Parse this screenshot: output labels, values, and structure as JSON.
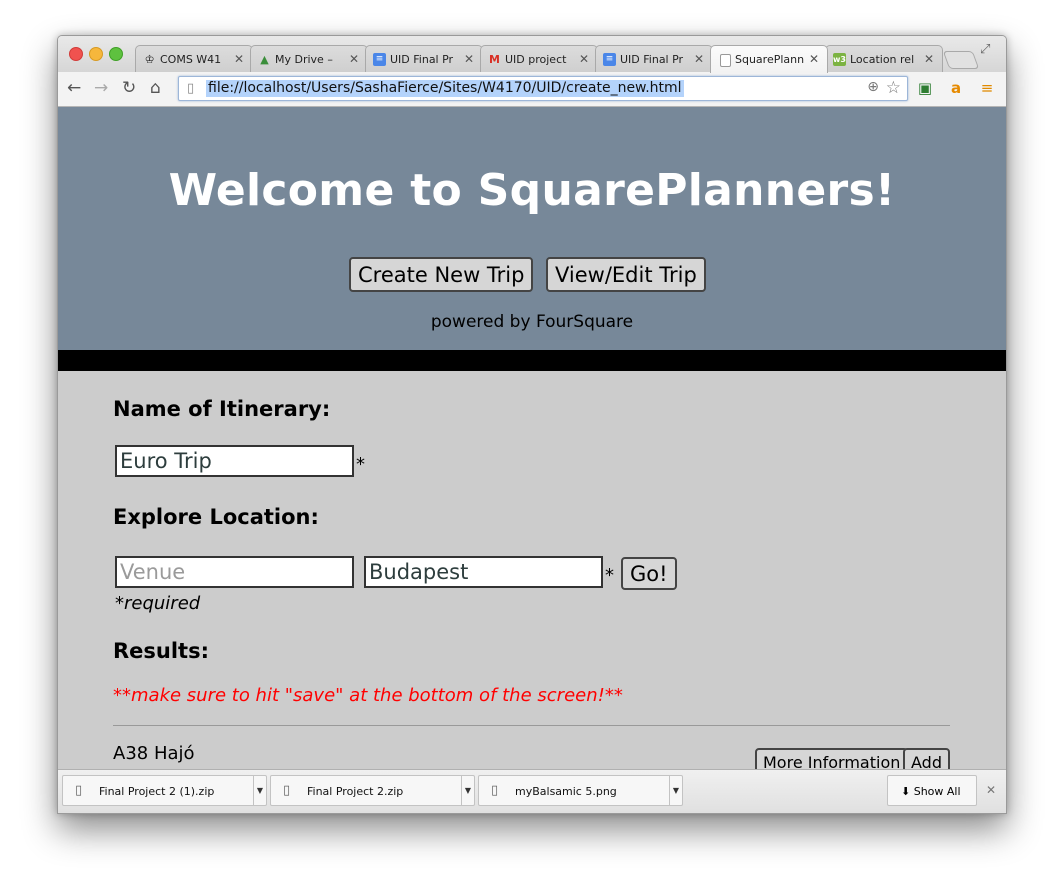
{
  "browser": {
    "tabs": [
      {
        "title": "COMS W41",
        "favicon": "crown-icon",
        "active": false
      },
      {
        "title": "My Drive –",
        "favicon": "google-drive-icon",
        "active": false
      },
      {
        "title": "UID Final Pr",
        "favicon": "google-docs-icon",
        "active": false
      },
      {
        "title": "UID project",
        "favicon": "gmail-icon",
        "active": false
      },
      {
        "title": "UID Final Pr",
        "favicon": "google-docs-icon",
        "active": false
      },
      {
        "title": "SquarePlann",
        "favicon": "page-icon",
        "active": true
      },
      {
        "title": "Location rel",
        "favicon": "w3c-icon",
        "active": false
      }
    ],
    "url": "file://localhost/Users/SashaFierce/Sites/W4170/UID/create_new.html"
  },
  "header": {
    "title": "Welcome to SquarePlanners!",
    "create_btn": "Create New Trip",
    "view_btn": "View/Edit Trip",
    "powered": "powered by FourSquare"
  },
  "form": {
    "name_label": "Name of Itinerary:",
    "name_value": "Euro Trip",
    "explore_label": "Explore Location:",
    "venue_placeholder": "Venue",
    "location_value": "Budapest",
    "asterisk": "*",
    "go_btn": "Go!",
    "required_note": "*required",
    "results_label": "Results:",
    "save_notice": "**make sure to hit \"save\" at the bottom of the screen!**"
  },
  "results": [
    {
      "name": "A38 Hajó",
      "more_btn": "More Information",
      "add_btn": "Add"
    }
  ],
  "downloads": {
    "items": [
      {
        "filename": "Final Project 2 (1).zip"
      },
      {
        "filename": "Final Project 2.zip"
      },
      {
        "filename": "myBalsamic 5.png"
      }
    ],
    "show_all": "Show All"
  },
  "colors": {
    "header_bg": "#778899",
    "page_bg": "#cccccc",
    "notice": "#ff0000"
  }
}
